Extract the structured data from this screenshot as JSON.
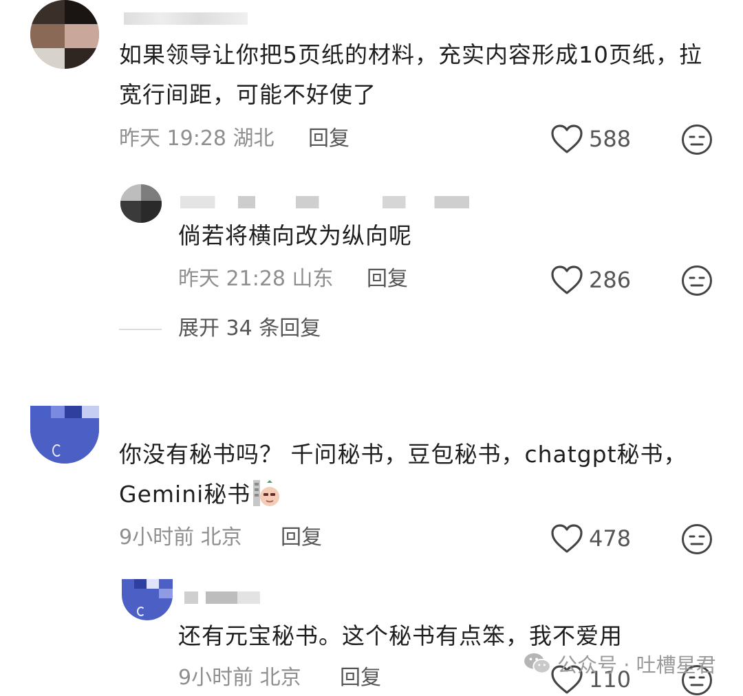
{
  "comments": [
    {
      "text": "如果领导让你把5页纸的材料，充实内容形成10页纸，拉宽行间距，可能不好使了",
      "time": "昨天 19:28",
      "location": "湖北",
      "reply_label": "回复",
      "likes": "588"
    },
    {
      "text": "倘若将横向改为纵向呢",
      "time": "昨天 21:28",
      "location": "山东",
      "reply_label": "回复",
      "likes": "286"
    },
    {
      "text": "你没有秘书吗？ 千问秘书，豆包秘书，chatgpt秘书，Gemini秘书",
      "time": "9小时前",
      "location": "北京",
      "reply_label": "回复",
      "likes": "478"
    },
    {
      "text": "还有元宝秘书。这个秘书有点笨，我不爱用",
      "time": "9小时前",
      "location": "北京",
      "reply_label": "回复",
      "likes": "110"
    }
  ],
  "expand_replies": "展开 34 条回复",
  "watermark": "公众号 · 吐槽星君",
  "icons": {
    "like": "heart-outline-icon",
    "dislike": "meh-face-icon",
    "emoji": "smug-face-emoji",
    "wechat": "wechat-logo-icon"
  },
  "colors": {
    "text": "#1e1e1e",
    "meta": "#8e8e8e",
    "action": "#555555"
  }
}
